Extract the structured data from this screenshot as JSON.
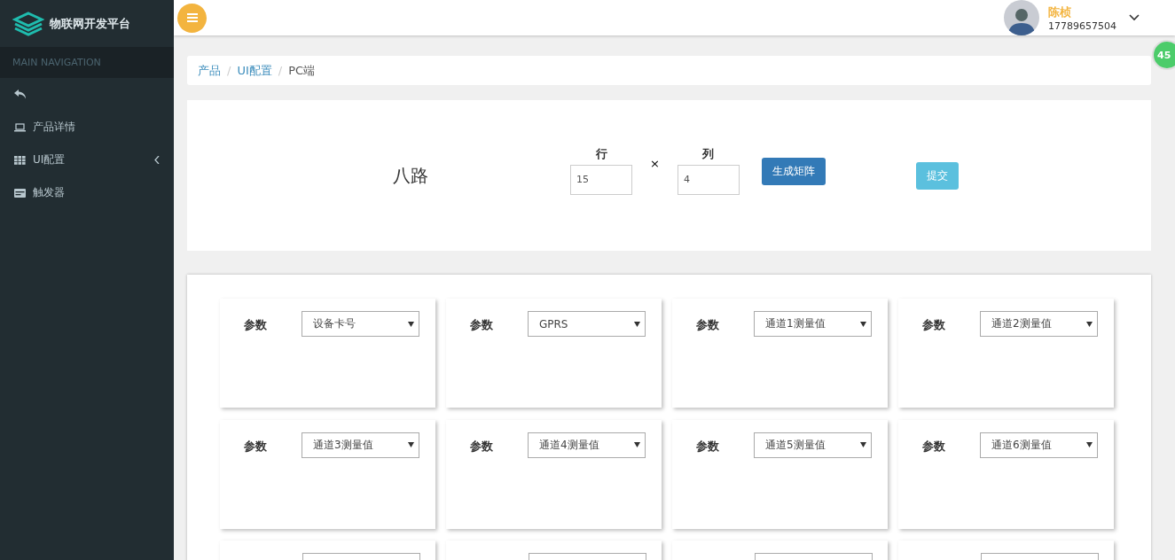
{
  "brand": {
    "title": "物联网开发平台"
  },
  "sidebar": {
    "header": "MAIN NAVIGATION",
    "items": [
      {
        "kind": "back"
      },
      {
        "kind": "laptop",
        "label": "产品详情"
      },
      {
        "kind": "grid",
        "label": "UI配置",
        "expanded": false
      },
      {
        "kind": "card",
        "label": "触发器"
      }
    ]
  },
  "user": {
    "name": "陈桢",
    "phone": "17789657504"
  },
  "badge": "45",
  "breadcrumb_separator": "/",
  "breadcrumb": [
    {
      "label": "产品",
      "link": true
    },
    {
      "label": "UI配置",
      "link": true
    },
    {
      "label": "PC端",
      "link": false
    }
  ],
  "matrix": {
    "title": "八路",
    "rows_label": "行",
    "rows_value": "15",
    "times": "×",
    "cols_label": "列",
    "cols_value": "4",
    "generate": "生成矩阵",
    "submit": "提交"
  },
  "cards": [
    {
      "kind": "param",
      "label": "参数",
      "value": "设备卡号"
    },
    {
      "kind": "param",
      "label": "参数",
      "value": "GPRS"
    },
    {
      "kind": "param",
      "label": "参数",
      "value": "通道1测量值"
    },
    {
      "kind": "param",
      "label": "参数",
      "value": "通道2测量值"
    },
    {
      "kind": "param",
      "label": "参数",
      "value": "通道3测量值"
    },
    {
      "kind": "param",
      "label": "参数",
      "value": "通道4测量值"
    },
    {
      "kind": "param",
      "label": "参数",
      "value": "通道5测量值"
    },
    {
      "kind": "param",
      "label": "参数",
      "value": "通道6测量值"
    },
    {
      "kind": "cut"
    },
    {
      "kind": "cut"
    },
    {
      "kind": "cut"
    },
    {
      "kind": "cut"
    }
  ]
}
